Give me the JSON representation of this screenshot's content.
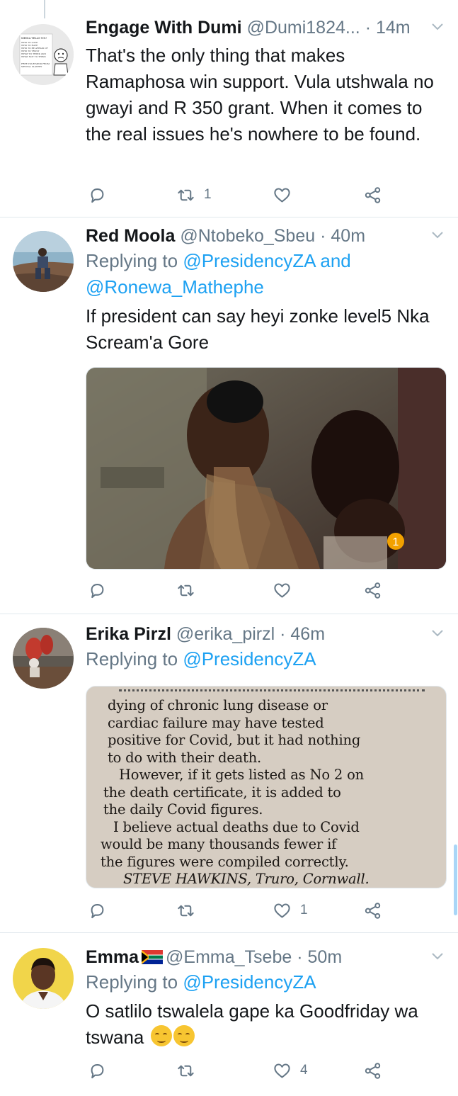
{
  "colors": {
    "accent": "#1da1f2",
    "secondary_text": "#657786",
    "primary_text": "#14171a",
    "divider": "#e1e8ed"
  },
  "icons": [
    "chevron-down-icon",
    "reply-icon",
    "retweet-icon",
    "like-icon",
    "share-icon",
    "flag-icon",
    "emoji-icon"
  ],
  "tweets": [
    {
      "name": "Engage With Dumi",
      "handle": "@Dumi1824...",
      "time": "· 14m",
      "reply_prefix": "",
      "reply_to": [],
      "text": "That's the only thing that makes Ramaphosa win support.  Vula utshwala no gwayi and R 350 grant.  When it comes to the real issues  he's nowhere to be found.",
      "counts": {
        "reply": "",
        "retweet": "1",
        "like": ""
      },
      "avatar_text": [
        "MEDIA TELLS YOU",
        "WHO TO LOVE",
        "WHO TO HATE",
        "WHO TO BE AFRAID OF",
        "WHO TO TRUST",
        "WHAT TO THINK AND",
        "WHAT NOT TO THINK",
        "FREE YOUR MIND FROM",
        "MENTAL SLAVERY"
      ]
    },
    {
      "name": "Red Moola",
      "handle": "@Ntobeko_Sbeu",
      "time": "· 40m",
      "reply_prefix": "Replying to",
      "reply_to": [
        "@PresidencyZA",
        "and",
        "@Ronewa_Mathephe"
      ],
      "text": "If president can say heyi zonke level5 Nka Scream'a Gore",
      "counts": {
        "reply": "",
        "retweet": "",
        "like": ""
      },
      "media_badge": "1"
    },
    {
      "name": "Erika Pirzl",
      "handle": "@erika_pirzl",
      "time": "· 46m",
      "reply_prefix": "Replying to",
      "reply_to": [
        "@PresidencyZA"
      ],
      "text": "",
      "counts": {
        "reply": "",
        "retweet": "",
        "like": "1"
      },
      "clipping_lines": [
        "dying of chronic lung disease or",
        "cardiac failure may have tested",
        "positive for Covid, but it had nothing",
        "to do with their death.",
        "However, if it gets listed as No 2 on",
        "the death certificate, it is added to",
        "the daily Covid figures.",
        "I believe actual deaths due to Covid",
        "would be many thousands fewer if",
        "the figures were compiled correctly.",
        "STEVE HAWKINS, Truro, Cornwall."
      ]
    },
    {
      "name": "Emma",
      "handle": "@Emma_Tsebe",
      "time": "· 50m",
      "reply_prefix": "Replying to",
      "reply_to": [
        "@PresidencyZA"
      ],
      "text_line1": "O satlilo tswalela gape ka Goodfriday wa",
      "text_line2": "tswana",
      "counts": {
        "reply": "",
        "retweet": "",
        "like": "4"
      }
    }
  ]
}
